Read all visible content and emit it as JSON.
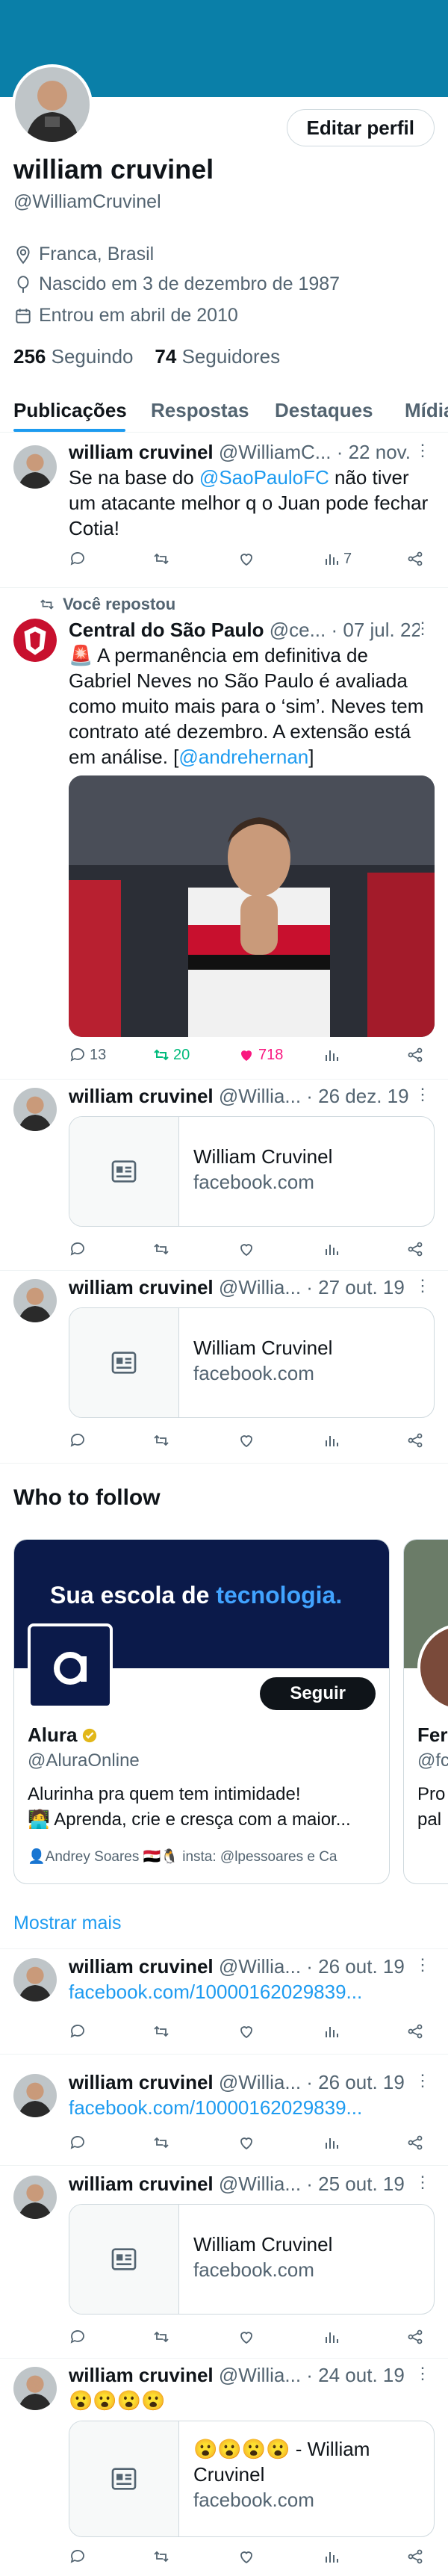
{
  "profile": {
    "name": "william cruvinel",
    "handle": "@WilliamCruvinel",
    "edit_label": "Editar perfil",
    "location": "Franca, Brasil",
    "birth": "Nascido em 3 de dezembro de 1987",
    "joined": "Entrou em abril de 2010",
    "following_count": "256",
    "following_label": "Seguindo",
    "followers_count": "74",
    "followers_label": "Seguidores"
  },
  "tabs": [
    "Publicações",
    "Respostas",
    "Destaques",
    "Mídia"
  ],
  "posts": [
    {
      "name": "william cruvinel",
      "handle": "@WilliamC...",
      "date": "· 22 nov.",
      "text_before": "Se na base do ",
      "mention": "@SaoPauloFC",
      "text_after": " não tiver um atacante melhor q o Juan pode fechar Cotia!",
      "views": "7"
    },
    {
      "repost_label": "Você repostou",
      "name": "Central do São Paulo",
      "handle": "@ce...",
      "date": "· 07 jul. 22",
      "text": "🚨 A permanência em definitiva de Gabriel Neves no São Paulo é avaliada como muito mais para o ‘sim’. Neves tem contrato até dezembro. A extensão está em análise. [",
      "mention": "@andrehernan",
      "text_end": "]",
      "replies": "13",
      "reposts": "20",
      "likes": "718"
    },
    {
      "name": "william cruvinel",
      "handle": "@Willia...",
      "date": "· 26 dez. 19",
      "card_title": "William Cruvinel",
      "card_domain": "facebook.com"
    },
    {
      "name": "william cruvinel",
      "handle": "@Willia...",
      "date": "· 27 out. 19",
      "card_title": "William Cruvinel",
      "card_domain": "facebook.com"
    },
    {
      "name": "william cruvinel",
      "handle": "@Willia...",
      "date": "· 26 out. 19",
      "link": "facebook.com/10000162029839..."
    },
    {
      "name": "william cruvinel",
      "handle": "@Willia...",
      "date": "· 26 out. 19",
      "link": "facebook.com/10000162029839..."
    },
    {
      "name": "william cruvinel",
      "handle": "@Willia...",
      "date": "· 25 out. 19",
      "card_title": "William Cruvinel",
      "card_domain": "facebook.com"
    },
    {
      "name": "william cruvinel",
      "handle": "@Willia...",
      "date": "· 24 out. 19",
      "text": "😮😮😮😮",
      "card_title": "😮😮😮😮 - William Cruvinel",
      "card_domain": "facebook.com"
    }
  ],
  "who_to_follow": {
    "title": "Who to follow",
    "banner_text": "Sua escola de ",
    "banner_highlight": "tecnologia.",
    "name": "Alura",
    "handle": "@AluraOnline",
    "follow_label": "Seguir",
    "bio_line1": "Alurinha pra quem tem intimidade!",
    "bio_line2": "🧑‍💻 Aprenda, crie e cresça com a maior...",
    "footer": "Andrey Soares 🇪🇬🐧 insta: @lpessoares e Ca",
    "next_name": "Fer",
    "next_handle": "@fc",
    "next_bio1": "Pro",
    "next_bio2": "pal",
    "show_more": "Mostrar mais"
  },
  "colors": {
    "accent": "#1d9bf0",
    "banner": "#0a7fa8",
    "like": "#f91880",
    "repost": "#00ba7c"
  }
}
